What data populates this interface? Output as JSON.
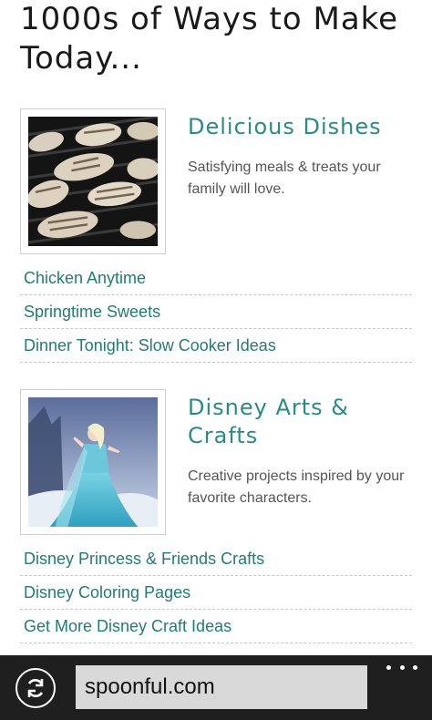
{
  "page": {
    "title": "1000s of Ways to Make Today..."
  },
  "sections": [
    {
      "title": "Delicious Dishes",
      "description": "Satisfying meals & treats your family will love.",
      "links": [
        "Chicken Anytime",
        "Springtime Sweets",
        "Dinner Tonight: Slow Cooker Ideas"
      ]
    },
    {
      "title": "Disney Arts & Crafts",
      "description": "Creative projects inspired by your favorite characters.",
      "links": [
        "Disney Princess & Friends Crafts",
        "Disney Coloring Pages",
        "Get More Disney Craft Ideas"
      ]
    }
  ],
  "appbar": {
    "address": "spoonful.com",
    "refresh_icon": "refresh-icon",
    "more_icon": "more-ellipsis-icon"
  },
  "colors": {
    "accent": "#2a8a84",
    "link": "#237b75",
    "appbar": "#1f1f1f"
  }
}
